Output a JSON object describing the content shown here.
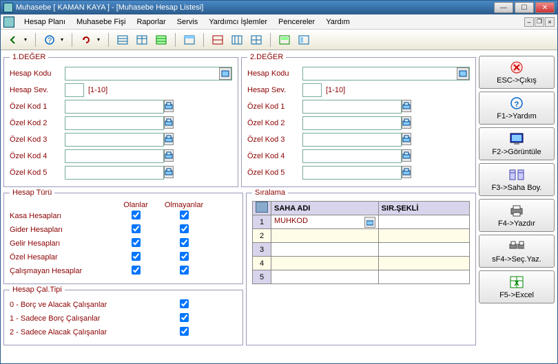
{
  "title": "Muhasebe [ KAMAN KAYA ]  - [Muhasebe Hesap Listesi]",
  "menu": {
    "hesap_plani": "Hesap Planı",
    "muhasebe_fisi": "Muhasebe Fişi",
    "raporlar": "Raporlar",
    "servis": "Servis",
    "yardimci_islemler": "Yardımcı İşlemler",
    "pencereler": "Pencereler",
    "yardim": "Yardım"
  },
  "groups": {
    "deger1": {
      "title": "1.DEĞER",
      "hesap_kodu": "Hesap Kodu",
      "hesap_sev": "Hesap Sev.",
      "range": "[1-10]",
      "ozel1": "Özel Kod 1",
      "ozel2": "Özel Kod 2",
      "ozel3": "Özel Kod 3",
      "ozel4": "Özel Kod 4",
      "ozel5": "Özel Kod 5"
    },
    "deger2": {
      "title": "2.DEĞER",
      "hesap_kodu": "Hesap Kodu",
      "hesap_sev": "Hesap Sev.",
      "range": "[1-10]",
      "ozel1": "Özel Kod 1",
      "ozel2": "Özel Kod 2",
      "ozel3": "Özel Kod 3",
      "ozel4": "Özel Kod 4",
      "ozel5": "Özel Kod 5"
    },
    "hesap_turu": {
      "title": "Hesap Türü",
      "col_olanlar": "Olanlar",
      "col_olmayanlar": "Olmayanlar",
      "rows": {
        "kasa": "Kasa Hesapları",
        "gider": "Gider Hesapları",
        "gelir": "Gelir Hesapları",
        "ozel": "Özel Hesaplar",
        "calismayan": "Çalışmayan Hesaplar"
      }
    },
    "hesap_cal": {
      "title": "Hesap Çal.Tipi",
      "r0": "0 - Borç ve Alacak Çalışanlar",
      "r1": "1 - Sadece Borç Çalışanlar",
      "r2": "2 - Sadece Alacak Çalışanlar"
    },
    "siralama": {
      "title": "Sıralama",
      "col_saha": "SAHA ADI",
      "col_sir": "SIR.ŞEKLİ",
      "row1_saha": "MUHKOD",
      "rows": {
        "r1": "1",
        "r2": "2",
        "r3": "3",
        "r4": "4",
        "r5": "5"
      }
    }
  },
  "buttons": {
    "esc": "ESC->Çıkış",
    "f1": "F1->Yardım",
    "f2": "F2->Görüntüle",
    "f3": "F3->Saha Boy.",
    "f4": "F4->Yazdır",
    "sf4": "sF4->Seç.Yaz.",
    "f5": "F5->Excel"
  }
}
